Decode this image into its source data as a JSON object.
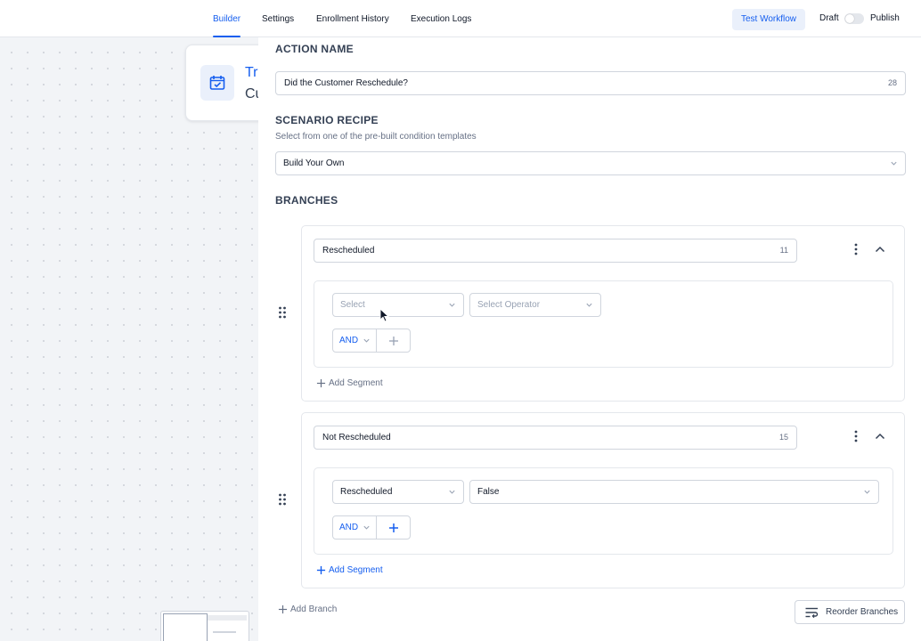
{
  "nav": {
    "tabs": [
      {
        "label": "Builder",
        "active": true
      },
      {
        "label": "Settings",
        "active": false
      },
      {
        "label": "Enrollment History",
        "active": false
      },
      {
        "label": "Execution Logs",
        "active": false
      }
    ],
    "test_label": "Test Workflow",
    "draft_label": "Draft",
    "publish_label": "Publish",
    "publish_enabled": false
  },
  "canvas": {
    "node": {
      "icon": "calendar-check-icon",
      "title": "Tr",
      "subtitle": "Cu"
    }
  },
  "panel": {
    "action_name": {
      "title": "ACTION NAME",
      "value": "Did the Customer Reschedule?",
      "count": "28"
    },
    "scenario": {
      "title": "SCENARIO RECIPE",
      "hint": "Select from one of the pre-built condition templates",
      "value": "Build Your Own"
    },
    "branches_title": "BRANCHES",
    "branches": [
      {
        "name": "Rescheduled",
        "count": "11",
        "field": "Select",
        "field_placeholder": true,
        "operator": "Select Operator",
        "operator_placeholder": true,
        "and_label": "AND",
        "add_segment": "Add Segment"
      },
      {
        "name": "Not Rescheduled",
        "count": "15",
        "field": "Rescheduled",
        "field_placeholder": false,
        "operator": "False",
        "operator_placeholder": false,
        "and_label": "AND",
        "add_segment": "Add Segment"
      }
    ],
    "add_branch": "Add Branch",
    "reorder": "Reorder Branches"
  },
  "colors": {
    "accent": "#155eef",
    "muted": "#667085",
    "border": "#d0d5dd"
  }
}
